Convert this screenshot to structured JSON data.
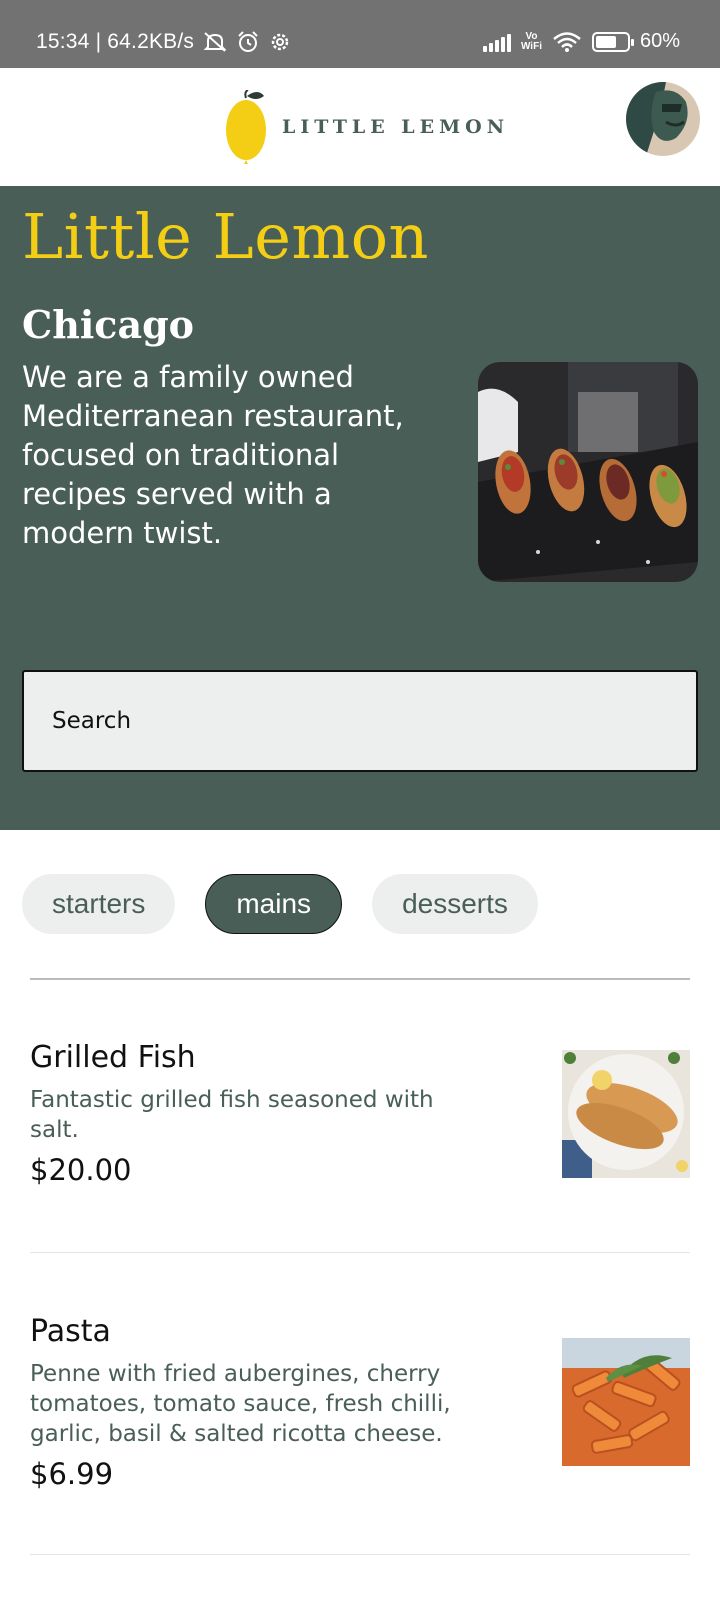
{
  "status_bar": {
    "time_speed": "15:34 | 64.2KB/s",
    "vowifi_top": "Vo",
    "vowifi_bottom": "WiFi",
    "battery": "60%",
    "icons": [
      "mute-icon",
      "alarm-icon",
      "settings-icon",
      "signal-icon",
      "wifi-icon",
      "battery-icon"
    ]
  },
  "header": {
    "logo_text": "LITTLE LEMON",
    "brand_colors": {
      "green": "#495E57",
      "yellow": "#F4CE14"
    }
  },
  "hero": {
    "title": "Little Lemon",
    "city": "Chicago",
    "description": "We are a family owned Mediterranean restaurant, focused on traditional recipes served with a modern twist.",
    "search_placeholder": "Search"
  },
  "categories": [
    {
      "label": "starters",
      "selected": false
    },
    {
      "label": "mains",
      "selected": true
    },
    {
      "label": "desserts",
      "selected": false
    }
  ],
  "menu_items": [
    {
      "name": "Grilled Fish",
      "description": "Fantastic grilled fish seasoned with salt.",
      "price": "$20.00"
    },
    {
      "name": "Pasta",
      "description": "Penne with fried aubergines, cherry tomatoes, tomato sauce, fresh chilli, garlic, basil & salted ricotta cheese.",
      "price": "$6.99"
    }
  ]
}
